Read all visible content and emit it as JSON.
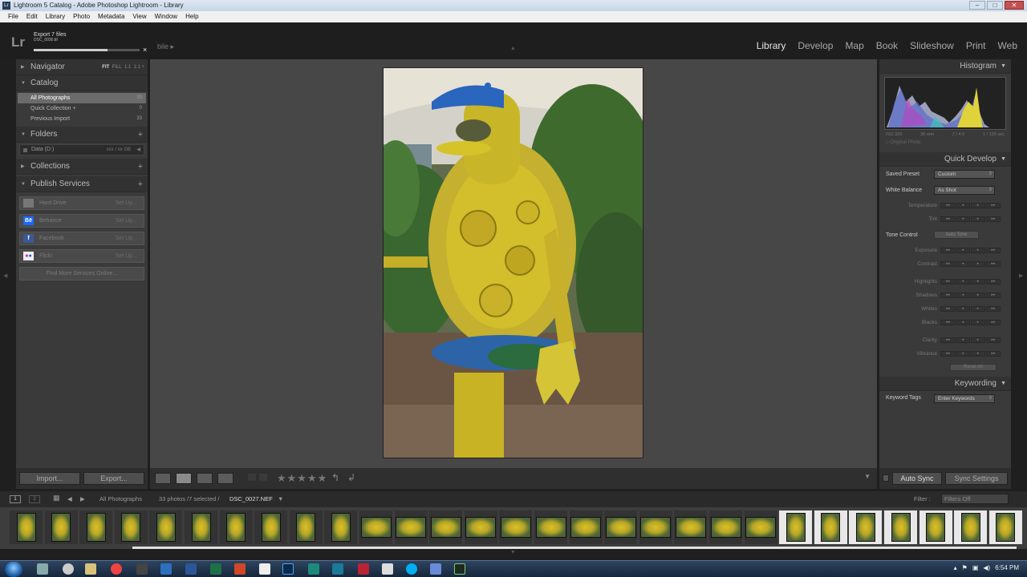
{
  "window": {
    "title": "Lightroom 5 Catalog - Adobe Photoshop Lightroom - Library",
    "controls": [
      "–",
      "□",
      "✕"
    ]
  },
  "menu": [
    "File",
    "Edit",
    "Library",
    "Photo",
    "Metadata",
    "View",
    "Window",
    "Help"
  ],
  "topbar": {
    "logo": "Lr",
    "export_title": "Export 7 files",
    "export_file": "DSC_0030.tif",
    "export_progress": 0.7,
    "export_close": "×",
    "mobile_fragment": "bile  ▸"
  },
  "modules": [
    "Library",
    "Develop",
    "Map",
    "Book",
    "Slideshow",
    "Print",
    "Web"
  ],
  "active_module": "Library",
  "left": {
    "navigator": {
      "label": "Navigator",
      "fit": "FIT",
      "fill": "FILL",
      "r1": "1:1",
      "r2": "1:1 ÷"
    },
    "catalog": {
      "label": "Catalog",
      "items": [
        {
          "label": "All Photographs",
          "count": "33"
        },
        {
          "label": "Quick Collection +",
          "count": "0"
        },
        {
          "label": "Previous Import",
          "count": "33"
        }
      ]
    },
    "folders": {
      "label": "Folders",
      "drive": "Data (D:)",
      "drive_size": "xxx / xx GB"
    },
    "collections": {
      "label": "Collections"
    },
    "publish": {
      "label": "Publish Services",
      "items": [
        {
          "label": "Hard Drive",
          "setup": "Set Up..."
        },
        {
          "label": "Behance",
          "setup": "Set Up..."
        },
        {
          "label": "Facebook",
          "setup": "Set Up..."
        },
        {
          "label": "Flickr",
          "setup": "Set Up..."
        }
      ],
      "find_more": "Find More Services Online..."
    },
    "import_btn": "Import...",
    "export_btn": "Export..."
  },
  "right": {
    "histogram": {
      "label": "Histogram",
      "iso": "ISO 320",
      "focal": "30 mm",
      "aperture": "ƒ / 4.0",
      "shutter": "1 / 120 sec",
      "original": "Original Photo"
    },
    "quick_develop": {
      "label": "Quick Develop",
      "saved_preset_label": "Saved Preset",
      "saved_preset": "Custom",
      "wb_label": "White Balance",
      "wb": "As Shot",
      "wb_adj": [
        "Temperature",
        "Tint"
      ],
      "tone_label": "Tone Control",
      "auto_tone": "Auto Tone",
      "tone_adj": [
        "Exposure",
        "Contrast"
      ],
      "tone_adj2": [
        "Highlights",
        "Shadows",
        "Whites",
        "Blacks"
      ],
      "presence_adj": [
        "Clarity",
        "Vibrance"
      ],
      "reset_all": "Reset All"
    },
    "keywording": {
      "label": "Keywording",
      "tags_label": "Keyword Tags",
      "tags_value": "Enter Keywords"
    },
    "auto_sync": "Auto Sync",
    "sync_settings": "Sync Settings"
  },
  "filmbar": {
    "mon1": "1",
    "mon2": "2",
    "source": "All Photographs",
    "status": "33 photos /7 selected /",
    "current_file": "DSC_0027.NEF",
    "filter_label": "Filter :",
    "filter_value": "Filters Off"
  },
  "clock": "6:54 PM",
  "colors": {
    "bg": "#1f1f1f",
    "panel": "#3a3a3a",
    "center": "#474747",
    "selected": "#6b6b6b",
    "sculpture": "#d8c326",
    "cap": "#2463b8"
  }
}
